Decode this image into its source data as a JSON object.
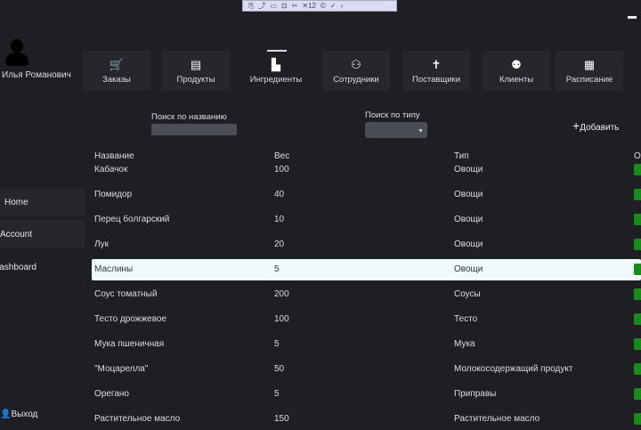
{
  "toolbar": {
    "items": [
      "⎘",
      "⤴",
      "▭",
      "⊡",
      "✂",
      "✕12",
      "©",
      "✓",
      "‹"
    ]
  },
  "user": {
    "name": "Илья Романович"
  },
  "nav": [
    {
      "label": "Заказы",
      "icon": "cart-icon",
      "glyph": "🛒"
    },
    {
      "label": "Продукты",
      "icon": "products-icon",
      "glyph": "▤"
    },
    {
      "label": "Ингредиенты",
      "icon": "ingredients-icon",
      "glyph": "▙"
    },
    {
      "label": "Сотрудники",
      "icon": "employees-icon",
      "glyph": "⚇"
    },
    {
      "label": "Поставщики",
      "icon": "suppliers-icon",
      "glyph": "✝"
    },
    {
      "label": "Клиенты",
      "icon": "clients-icon",
      "glyph": "⚉"
    },
    {
      "label": "Расписание",
      "icon": "schedule-icon",
      "glyph": "▦"
    }
  ],
  "filters": {
    "name_label": "Поиск по названию",
    "name_value": "",
    "type_label": "Поиск по типу",
    "type_value": "",
    "add_label": "Добавить"
  },
  "sidebar": {
    "items": [
      "Home",
      "Account",
      "Dashboard"
    ],
    "logout": "Выход"
  },
  "table": {
    "headers": [
      "Название",
      "Вес",
      "Тип",
      "О"
    ],
    "rows": [
      [
        "Кабачок",
        "100",
        "Овощи"
      ],
      [
        "Помидор",
        "40",
        "Овощи"
      ],
      [
        "Перец болгарский",
        "10",
        "Овощи"
      ],
      [
        "Лук",
        "20",
        "Овощи"
      ],
      [
        "Маслины",
        "5",
        "Овощи"
      ],
      [
        "Соус томатный",
        "200",
        "Соусы"
      ],
      [
        "Тесто дрожжевое",
        "100",
        "Тесто"
      ],
      [
        "Мука пшеничная",
        "5",
        "Мука"
      ],
      [
        "\"Моцарелла\"",
        "50",
        "Молокосодержащий продукт"
      ],
      [
        "Орегано",
        "5",
        "Приправы"
      ],
      [
        "Растительное масло",
        "150",
        "Растительное масло"
      ]
    ],
    "selected_row": 4
  }
}
